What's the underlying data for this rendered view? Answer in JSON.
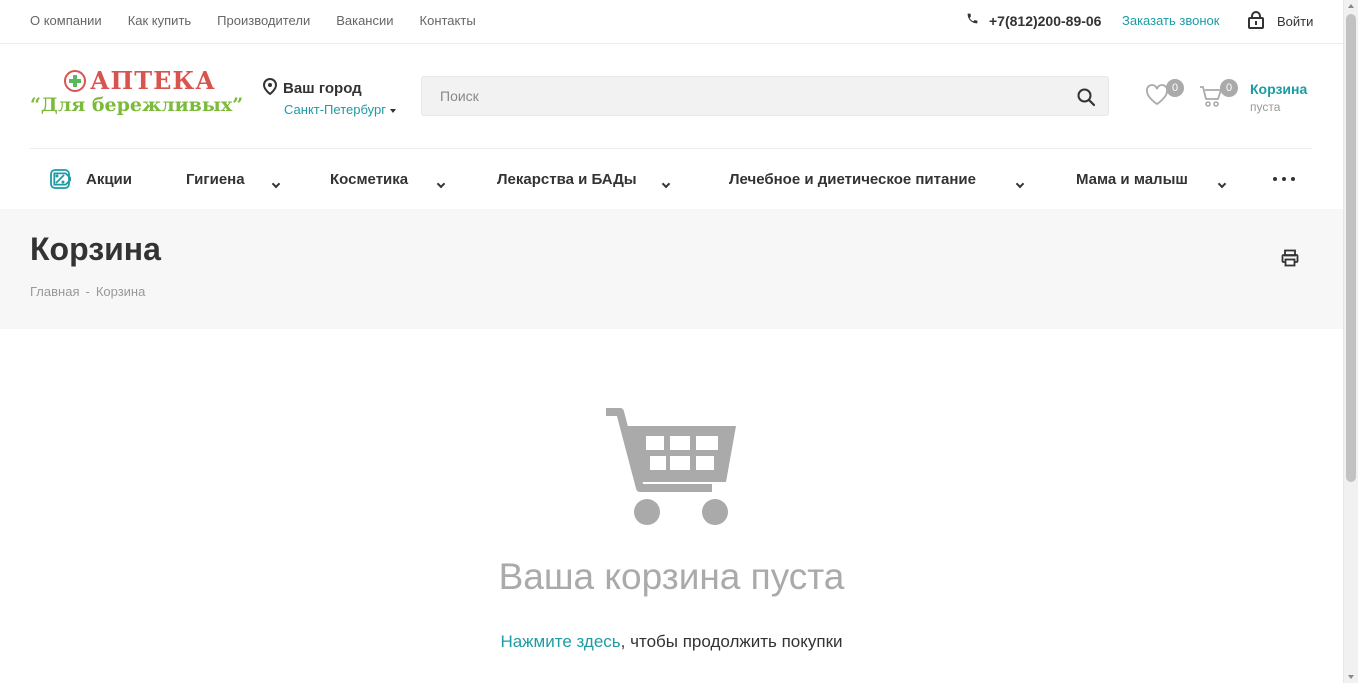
{
  "topbar": {
    "nav": [
      "О компании",
      "Как купить",
      "Производители",
      "Вакансии",
      "Контакты"
    ],
    "phone": "+7(812)200-89-06",
    "callback": "Заказать звонок",
    "login": "Войти"
  },
  "header": {
    "logo_title": "АПТЕКА",
    "logo_subtitle": "“Для бережливых”",
    "city_label": "Ваш город",
    "city_value": "Санкт-Петербург",
    "search_placeholder": "Поиск",
    "favorites_count": "0",
    "cart_count": "0",
    "cart_title": "Корзина",
    "cart_status": "пуста"
  },
  "menu": {
    "items": [
      "Акции",
      "Гигиена",
      "Косметика",
      "Лекарства и БАДы",
      "Лечебное и диетическое питание",
      "Мама и малыш"
    ]
  },
  "page": {
    "title": "Корзина",
    "breadcrumbs": [
      "Главная",
      "Корзина"
    ],
    "breadcrumb_separator": "-"
  },
  "empty_cart": {
    "title": "Ваша корзина пуста",
    "link_text": "Нажмите здесь",
    "note_rest": ", чтобы продолжить покупки"
  },
  "colors": {
    "accent": "#1d9ba3",
    "logo_red": "#d9534f",
    "logo_green": "#7cbb3a"
  }
}
